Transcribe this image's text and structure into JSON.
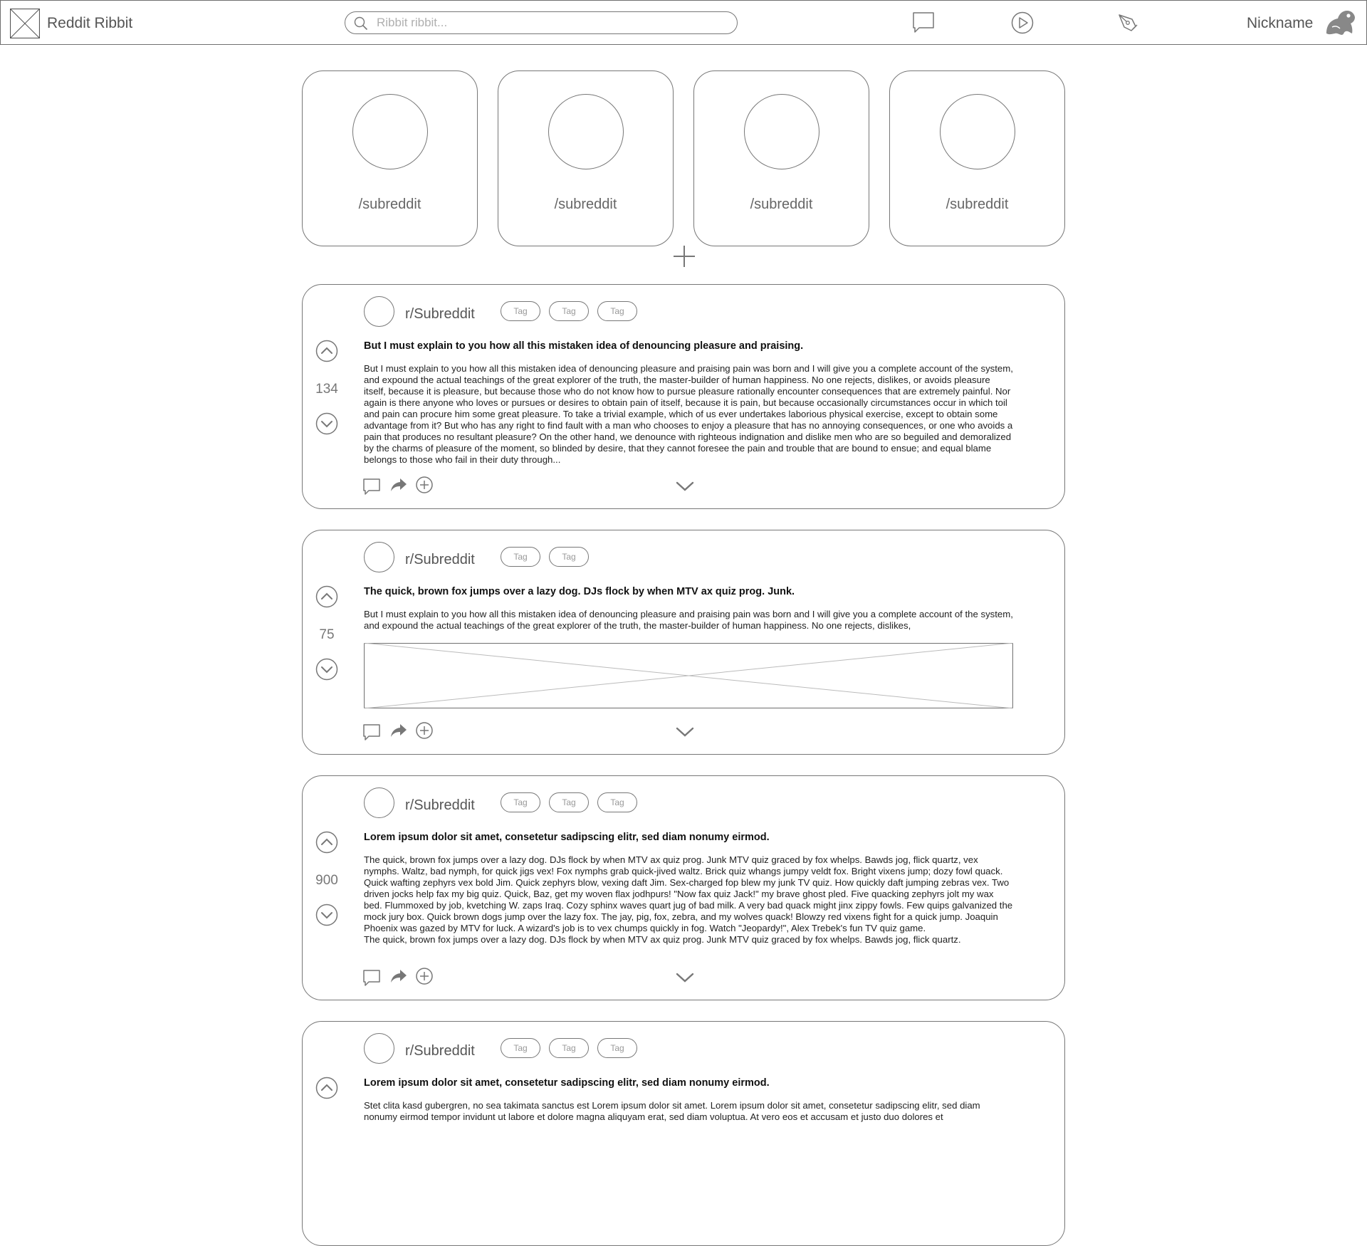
{
  "app": {
    "title": "Reddit Ribbit"
  },
  "search": {
    "placeholder": "Ribbit ribbit..."
  },
  "header": {
    "nickname": "Nickname"
  },
  "subreddits": [
    {
      "label": "/subreddit"
    },
    {
      "label": "/subreddit"
    },
    {
      "label": "/subreddit"
    },
    {
      "label": "/subreddit"
    }
  ],
  "posts": [
    {
      "subreddit": "r/Subreddit",
      "tags": [
        "Tag",
        "Tag",
        "Tag"
      ],
      "score": "134",
      "title": "But I must explain to you how all this mistaken idea of denouncing pleasure and praising.",
      "body": "But I must explain to you how all this mistaken idea of denouncing pleasure and praising pain was born and I will give you a complete account of the system, and expound the actual teachings of the great explorer of the truth, the master-builder of human happiness. No one rejects, dislikes, or avoids pleasure itself, because it is pleasure, but because those who do not know how to pursue pleasure rationally encounter consequences that are extremely painful. Nor again is there anyone who loves or pursues or desires to obtain pain of itself, because it is pain, but because occasionally circumstances occur in which toil and pain can procure him some great pleasure. To take a trivial example, which of us ever undertakes laborious physical exercise, except to obtain some advantage from it? But who has any right to find fault with a man who chooses to enjoy a pleasure that has no annoying consequences, or one who avoids a pain that produces no resultant pleasure? On the other hand, we denounce with righteous indignation and dislike men who are so beguiled and demoralized by the charms of pleasure of the moment, so blinded by desire, that they cannot foresee the pain and trouble that are bound to ensue; and equal blame belongs to those who fail in their duty through..."
    },
    {
      "subreddit": "r/Subreddit",
      "tags": [
        "Tag",
        "Tag"
      ],
      "score": "75",
      "title": "The quick, brown fox jumps over a lazy dog. DJs flock by when MTV ax quiz prog. Junk.",
      "body": "But I must explain to you how all this mistaken idea of denouncing pleasure and praising pain was born and I will give you a complete account of the system, and expound the actual teachings of the great explorer of the truth, the master-builder of human happiness. No one rejects, dislikes,"
    },
    {
      "subreddit": "r/Subreddit",
      "tags": [
        "Tag",
        "Tag",
        "Tag"
      ],
      "score": "900",
      "title": "Lorem ipsum dolor sit amet, consetetur sadipscing elitr, sed diam nonumy eirmod.",
      "body": "The quick, brown fox jumps over a lazy dog. DJs flock by when MTV ax quiz prog. Junk MTV quiz graced by fox whelps. Bawds jog, flick quartz, vex nymphs. Waltz, bad nymph, for quick jigs vex! Fox nymphs grab quick-jived waltz. Brick quiz whangs jumpy veldt fox. Bright vixens jump; dozy fowl quack. Quick wafting zephyrs vex bold Jim. Quick zephyrs blow, vexing daft Jim. Sex-charged fop blew my junk TV quiz. How quickly daft jumping zebras vex. Two driven jocks help fax my big quiz. Quick, Baz, get my woven flax jodhpurs! \"Now fax quiz Jack!\" my brave ghost pled. Five quacking zephyrs jolt my wax bed. Flummoxed by job, kvetching W. zaps Iraq. Cozy sphinx waves quart jug of bad milk. A very bad quack might jinx zippy fowls. Few quips galvanized the mock jury box. Quick brown dogs jump over the lazy fox. The jay, pig, fox, zebra, and my wolves quack! Blowzy red vixens fight for a quick jump. Joaquin Phoenix was gazed by MTV for luck. A wizard's job is to vex chumps quickly in fog. Watch \"Jeopardy!\", Alex Trebek's fun TV quiz game.\nThe quick, brown fox jumps over a lazy dog. DJs flock by when MTV ax quiz prog. Junk MTV quiz graced by fox whelps. Bawds jog, flick quartz."
    },
    {
      "subreddit": "r/Subreddit",
      "tags": [
        "Tag",
        "Tag",
        "Tag"
      ],
      "title": "Lorem ipsum dolor sit amet, consetetur sadipscing elitr, sed diam nonumy eirmod.",
      "body": "Stet clita kasd gubergren, no sea takimata sanctus est Lorem ipsum dolor sit amet. Lorem ipsum dolor sit amet, consetetur sadipscing elitr, sed diam nonumy eirmod tempor invidunt ut labore et dolore magna aliquyam erat, sed diam voluptua. At vero eos et accusam et justo duo dolores et"
    }
  ]
}
